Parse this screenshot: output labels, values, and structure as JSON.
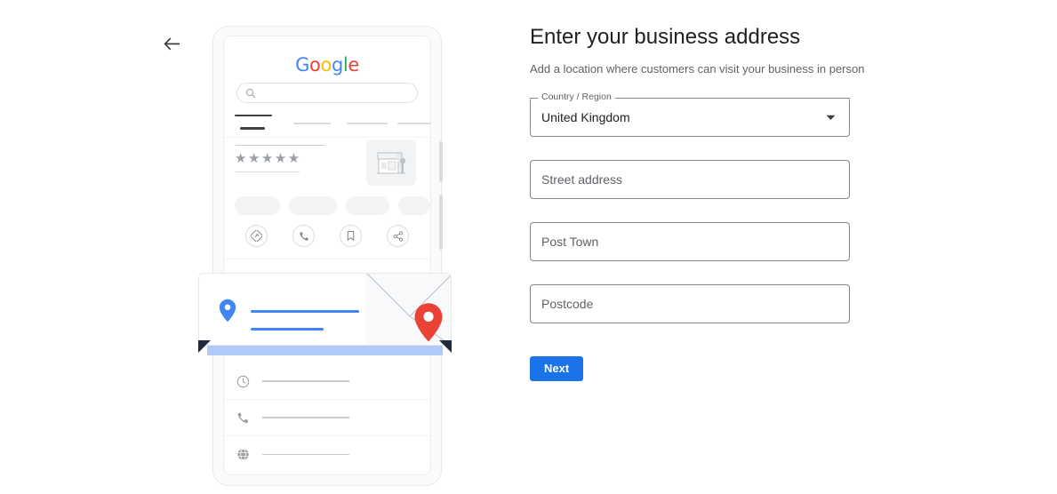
{
  "nav": {
    "back_icon": "arrow-left-icon"
  },
  "phone_preview": {
    "brand": {
      "icon": "google-logo",
      "letters": [
        {
          "ch": "G",
          "color": "#4285f4"
        },
        {
          "ch": "o",
          "color": "#ea4335"
        },
        {
          "ch": "o",
          "color": "#fbbc05"
        },
        {
          "ch": "g",
          "color": "#4285f4"
        },
        {
          "ch": "l",
          "color": "#34a853"
        },
        {
          "ch": "e",
          "color": "#ea4335"
        }
      ]
    },
    "search": {
      "icon": "search-icon",
      "placeholder": ""
    },
    "tabs": [
      {
        "name": "tab-active",
        "state": "active"
      },
      {
        "name": "tab-2",
        "state": "inactive"
      },
      {
        "name": "tab-3",
        "state": "inactive"
      },
      {
        "name": "tab-4",
        "state": "inactive"
      }
    ],
    "rating": {
      "stars": "★★★★★",
      "star_count": 5
    },
    "thumbnail": {
      "icon": "storefront-image-placeholder"
    },
    "chips": [
      "chip-1",
      "chip-2",
      "chip-3",
      "chip-4"
    ],
    "actions": [
      {
        "name": "directions-icon",
        "label": "Directions"
      },
      {
        "name": "call-icon",
        "label": "Call"
      },
      {
        "name": "save-icon",
        "label": "Save"
      },
      {
        "name": "share-icon",
        "label": "Share"
      }
    ],
    "info_rows": [
      {
        "icon": "clock-icon",
        "label": "Hours"
      },
      {
        "icon": "phone-icon",
        "label": "Phone"
      },
      {
        "icon": "globe-icon",
        "label": "Website"
      }
    ],
    "envelope": {
      "pin_left_icon": "map-pin-blue-icon",
      "pin_right_icon": "map-pin-red-icon",
      "accent_color": "#4285f4",
      "bar_color": "#aecbfa"
    }
  },
  "form": {
    "title": "Enter your business address",
    "subtitle": "Add a location where customers can visit your business in person",
    "country": {
      "label": "Country / Region",
      "value": "United Kingdom",
      "caret_icon": "chevron-down-icon"
    },
    "street": {
      "placeholder": "Street address",
      "value": ""
    },
    "post_town": {
      "placeholder": "Post Town",
      "value": ""
    },
    "postcode": {
      "placeholder": "Postcode",
      "value": ""
    },
    "next_label": "Next",
    "accent_color": "#1a73e8"
  }
}
